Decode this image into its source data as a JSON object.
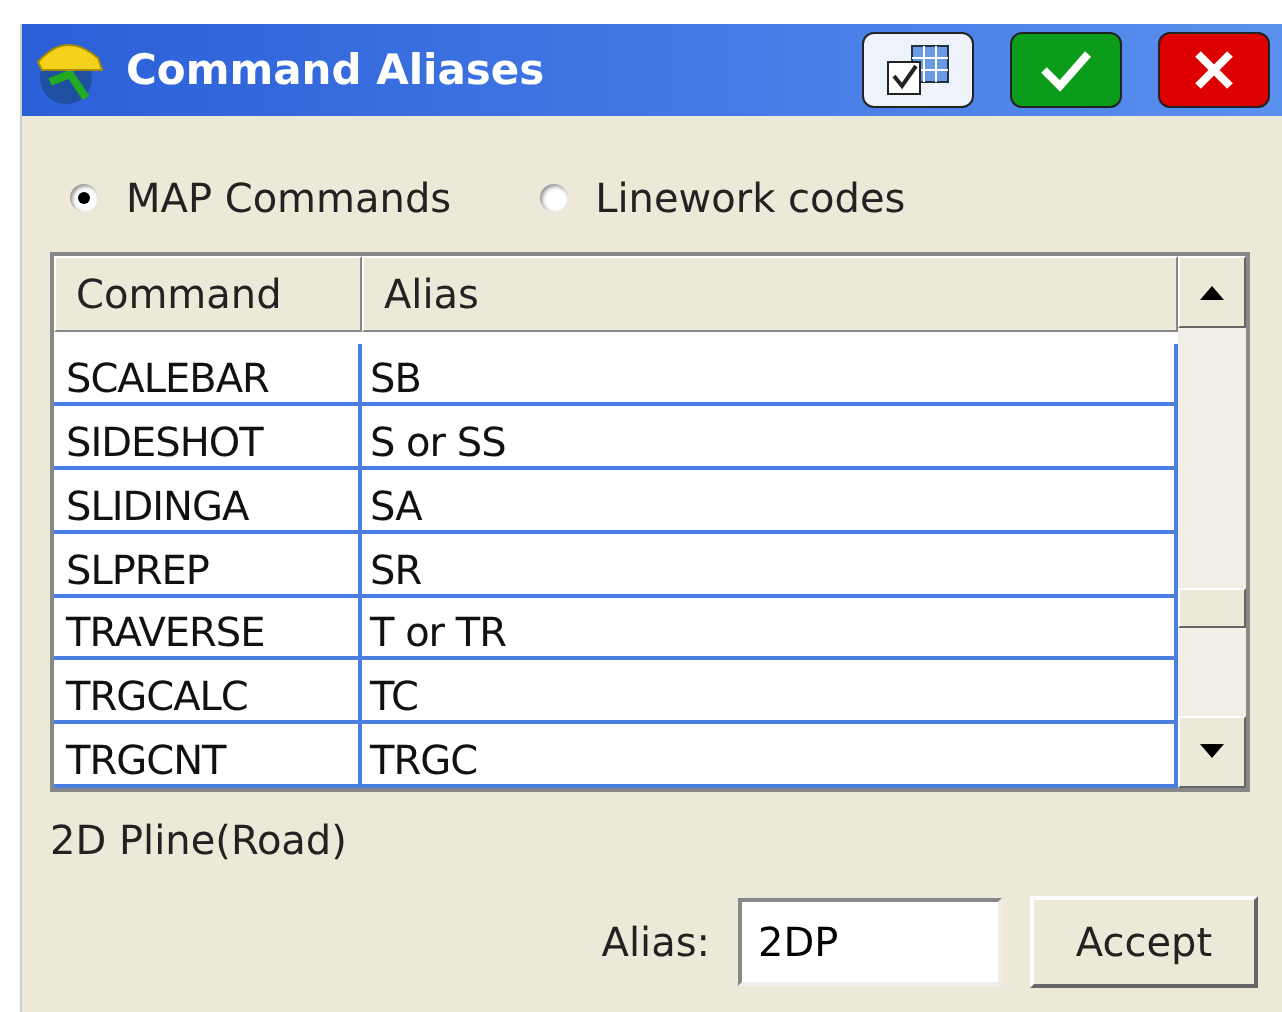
{
  "window": {
    "title": "Command Aliases"
  },
  "mode_options": [
    {
      "label": "MAP Commands",
      "selected": true
    },
    {
      "label": "Linework codes",
      "selected": false
    }
  ],
  "table": {
    "columns": [
      "Command",
      "Alias"
    ],
    "rows": [
      {
        "command": "SCALEBAR",
        "alias": "SB"
      },
      {
        "command": "SIDESHOT",
        "alias": "S or SS"
      },
      {
        "command": "SLIDINGA",
        "alias": "SA"
      },
      {
        "command": "SLPREP",
        "alias": "SR"
      },
      {
        "command": "TRAVERSE",
        "alias": "T or TR"
      },
      {
        "command": "TRGCALC",
        "alias": "TC"
      },
      {
        "command": "TRGCNT",
        "alias": "TRGC"
      }
    ]
  },
  "description": "2D Pline(Road)",
  "alias_field": {
    "label": "Alias:",
    "value": "2DP"
  },
  "accept_button": "Accept"
}
